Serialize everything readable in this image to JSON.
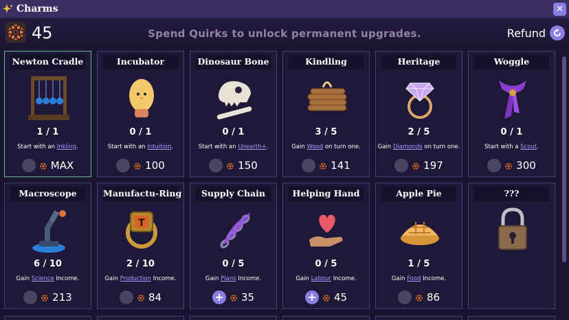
{
  "window": {
    "title": "Charms",
    "close_label": "✕"
  },
  "header": {
    "quirk_count": "45",
    "subtitle": "Spend Quirks to unlock permanent upgrades.",
    "refund_label": "Refund"
  },
  "cards": [
    {
      "title": "Newton Cradle",
      "level": "1 / 1",
      "desc_pre": "Start with an ",
      "desc_link": "Inkling",
      "desc_post": ".",
      "cost": "MAX",
      "selected": true,
      "can_buy": false,
      "art": "newton-cradle"
    },
    {
      "title": "Incubator",
      "level": "0 / 1",
      "desc_pre": "Start with an ",
      "desc_link": "Intuition",
      "desc_post": ".",
      "cost": "100",
      "can_buy": false,
      "art": "egg"
    },
    {
      "title": "Dinosaur Bone",
      "level": "0 / 1",
      "desc_pre": "Start with an ",
      "desc_link": "Unearth+",
      "desc_post": ".",
      "cost": "150",
      "can_buy": false,
      "art": "dino-skull"
    },
    {
      "title": "Kindling",
      "level": "3 / 5",
      "desc_pre": "Gain ",
      "desc_link": "Wood",
      "desc_post": " on turn one.",
      "cost": "141",
      "can_buy": false,
      "art": "wood-bundle"
    },
    {
      "title": "Heritage",
      "level": "2 / 5",
      "desc_pre": "Gain ",
      "desc_link": "Diamonds",
      "desc_post": " on turn one.",
      "cost": "197",
      "can_buy": false,
      "art": "diamond-ring"
    },
    {
      "title": "Woggle",
      "level": "0 / 1",
      "desc_pre": "Start with a ",
      "desc_link": "Scout",
      "desc_post": ".",
      "cost": "300",
      "can_buy": false,
      "art": "scarf"
    },
    {
      "title": "Macroscope",
      "level": "6 / 10",
      "desc_pre": "Gain ",
      "desc_link": "Science",
      "desc_post": " Income.",
      "cost": "213",
      "can_buy": false,
      "art": "microscope"
    },
    {
      "title": "Manufactu-Ring",
      "level": "2 / 10",
      "desc_pre": "Gain ",
      "desc_link": "Production",
      "desc_post": " Income.",
      "cost": "84",
      "can_buy": false,
      "art": "gold-ring"
    },
    {
      "title": "Supply Chain",
      "level": "0 / 5",
      "desc_pre": "Gain ",
      "desc_link": "Plans",
      "desc_post": " Income.",
      "cost": "35",
      "can_buy": true,
      "art": "chain-feather"
    },
    {
      "title": "Helping Hand",
      "level": "0 / 5",
      "desc_pre": "Gain ",
      "desc_link": "Labour",
      "desc_post": " Income.",
      "cost": "45",
      "can_buy": true,
      "art": "hand-heart"
    },
    {
      "title": "Apple Pie",
      "level": "1 / 5",
      "desc_pre": "Gain ",
      "desc_link": "Food",
      "desc_post": " Income.",
      "cost": "86",
      "can_buy": false,
      "art": "pie"
    },
    {
      "title": "???",
      "level": "",
      "desc_pre": "",
      "desc_link": "",
      "desc_post": "",
      "cost": "",
      "can_buy": false,
      "art": "padlock"
    }
  ],
  "colors": {
    "accent": "#8a7fe0",
    "link": "#a89cff",
    "selected_border": "#5fbf87",
    "card_border": "#4a3f74"
  }
}
